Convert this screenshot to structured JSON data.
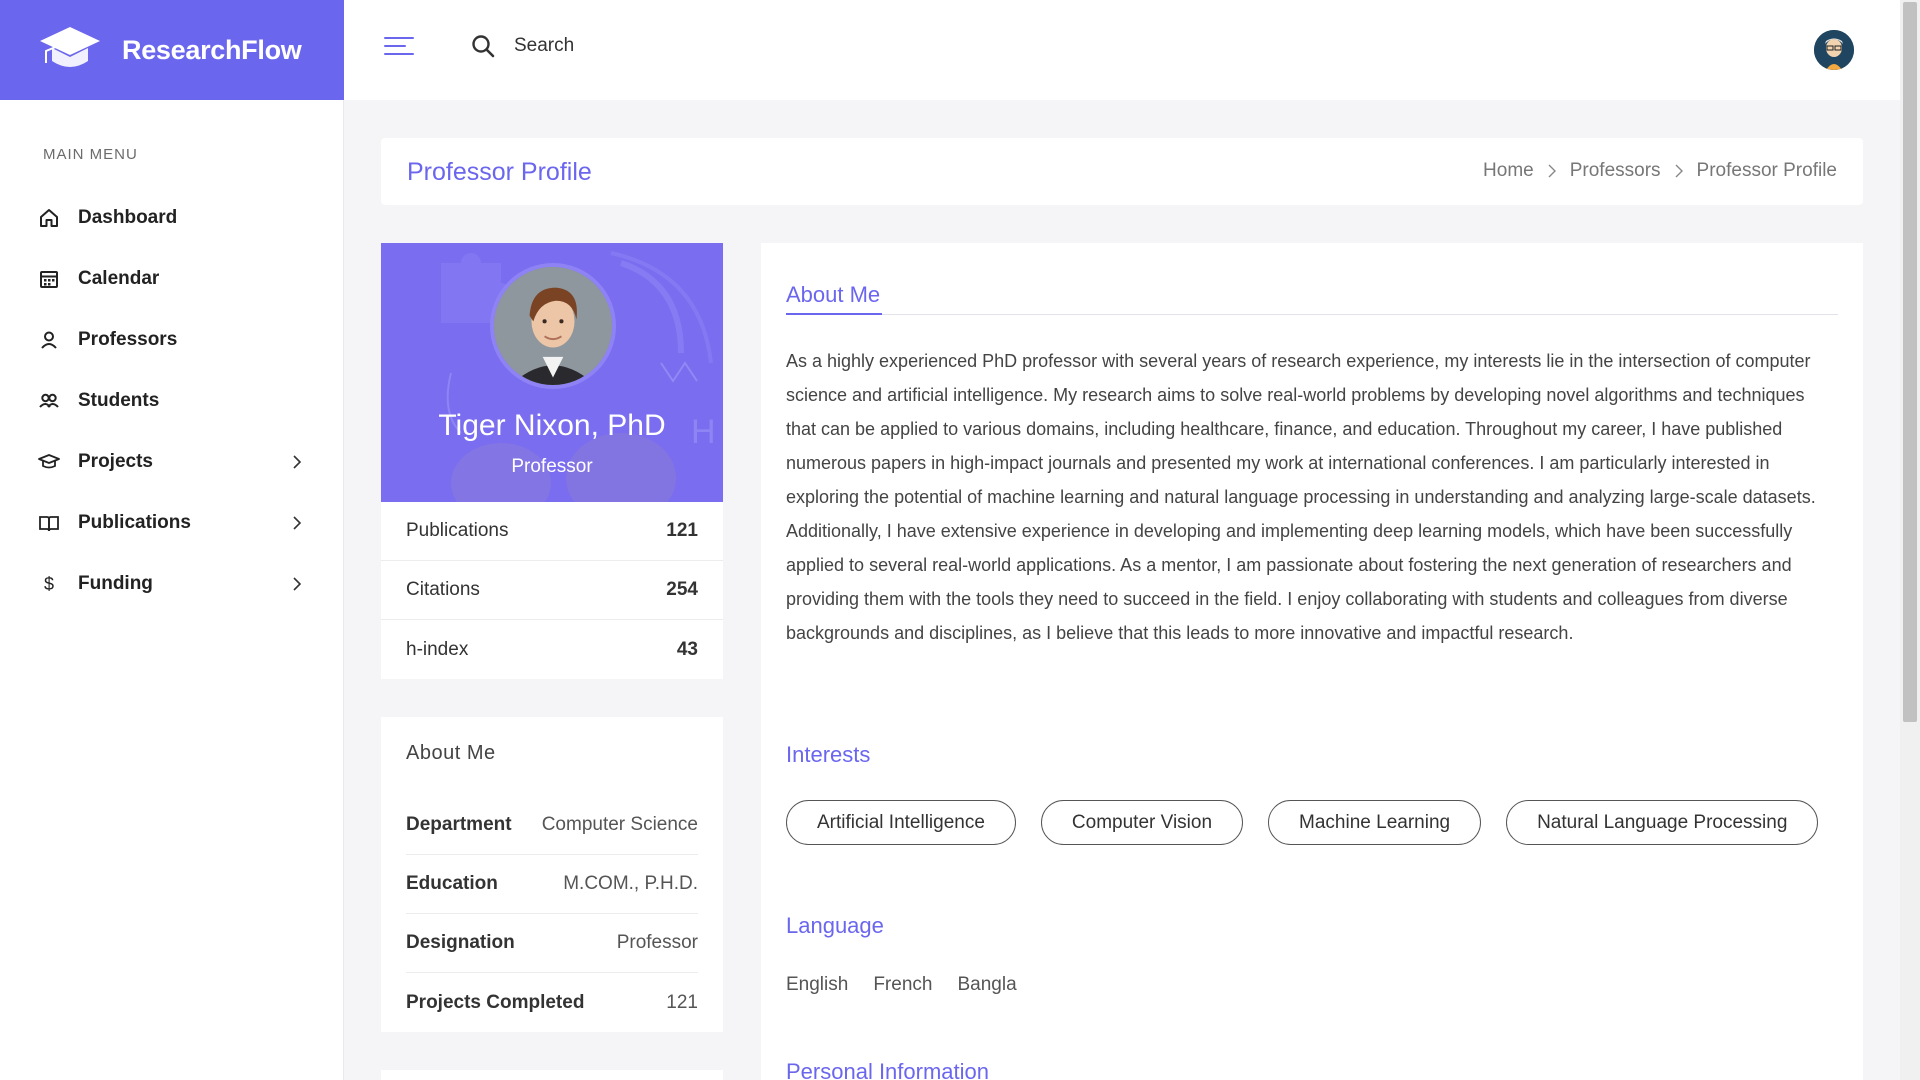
{
  "app": {
    "name": "ResearchFlow"
  },
  "header": {
    "search_placeholder": "Search"
  },
  "sidebar": {
    "title": "MAIN MENU",
    "items": [
      {
        "label": "Dashboard",
        "icon": "home-icon",
        "has_children": false
      },
      {
        "label": "Calendar",
        "icon": "calendar-icon",
        "has_children": false
      },
      {
        "label": "Professors",
        "icon": "user-icon",
        "has_children": false
      },
      {
        "label": "Students",
        "icon": "users-icon",
        "has_children": false
      },
      {
        "label": "Projects",
        "icon": "graduation-cap-icon",
        "has_children": true
      },
      {
        "label": "Publications",
        "icon": "book-icon",
        "has_children": true
      },
      {
        "label": "Funding",
        "icon": "dollar-icon",
        "has_children": true
      }
    ]
  },
  "page": {
    "title": "Professor Profile",
    "breadcrumb": [
      "Home",
      "Professors",
      "Professor Profile"
    ]
  },
  "profile": {
    "name": "Tiger Nixon, PhD",
    "role": "Professor",
    "stats": [
      {
        "label": "Publications",
        "value": "121"
      },
      {
        "label": "Citations",
        "value": "254"
      },
      {
        "label": "h-index",
        "value": "43"
      }
    ]
  },
  "about_card": {
    "title": "About Me",
    "rows": [
      {
        "key": "Department",
        "value": "Computer Science"
      },
      {
        "key": "Education",
        "value": "M.COM., P.H.D."
      },
      {
        "key": "Designation",
        "value": "Professor"
      },
      {
        "key": "Projects Completed",
        "value": "121"
      }
    ]
  },
  "main": {
    "about_title": "About Me",
    "about_text": "As a highly experienced PhD professor with several years of research experience, my interests lie in the intersection of computer science and artificial intelligence. My research aims to solve real-world problems by developing novel algorithms and techniques that can be applied to various domains, including healthcare, finance, and education. Throughout my career, I have published numerous papers in high-impact journals and presented my work at international conferences. I am particularly interested in exploring the potential of machine learning and natural language processing in understanding and analyzing large-scale datasets. Additionally, I have extensive experience in developing and implementing deep learning models, which have been successfully applied to several real-world applications. As a mentor, I am passionate about fostering the next generation of researchers and providing them with the tools they need to succeed in the field. I enjoy collaborating with students and colleagues from diverse backgrounds and disciplines, as I believe that this leads to more innovative and impactful research.",
    "interests_title": "Interests",
    "interests": [
      "Artificial Intelligence",
      "Computer Vision",
      "Machine Learning",
      "Natural Language Processing"
    ],
    "language_title": "Language",
    "languages": [
      "English",
      "French",
      "Bangla"
    ],
    "personal_title": "Personal Information"
  },
  "colors": {
    "accent": "#6b66ee",
    "banner": "#7a6df0"
  }
}
